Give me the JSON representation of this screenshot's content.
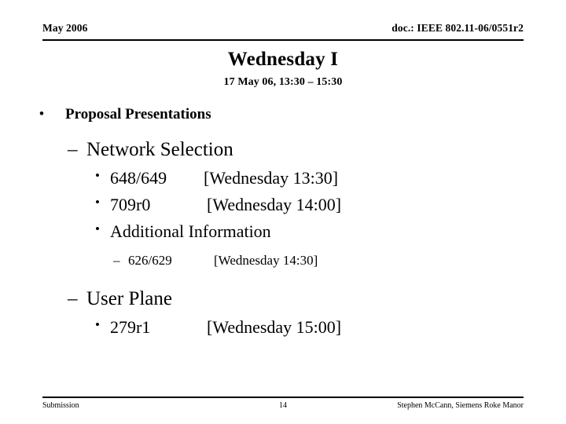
{
  "header": {
    "left": "May 2006",
    "right": "doc.: IEEE 802.11-06/0551r2"
  },
  "title": {
    "heading": "Wednesday I",
    "subheading": "17 May 06, 13:30 – 15:30"
  },
  "outline": {
    "proposal_presentations": {
      "marker": "•",
      "label": "Proposal Presentations"
    },
    "network_selection": {
      "marker": "–",
      "label": "Network Selection"
    },
    "item_648": {
      "marker": "•",
      "label": "648/649",
      "time": "[Wednesday 13:30]"
    },
    "item_709": {
      "marker": "•",
      "label": "709r0",
      "time": "[Wednesday 14:00]"
    },
    "item_additional": {
      "marker": "•",
      "label": "Additional Information"
    },
    "item_626": {
      "marker": "–",
      "label": "626/629",
      "time": "[Wednesday 14:30]"
    },
    "user_plane": {
      "marker": "–",
      "label": "User Plane"
    },
    "item_279": {
      "marker": "•",
      "label": "279r1",
      "time": "[Wednesday 15:00]"
    }
  },
  "footer": {
    "left": "Submission",
    "page_number": "14",
    "right": "Stephen McCann, Siemens Roke Manor"
  }
}
